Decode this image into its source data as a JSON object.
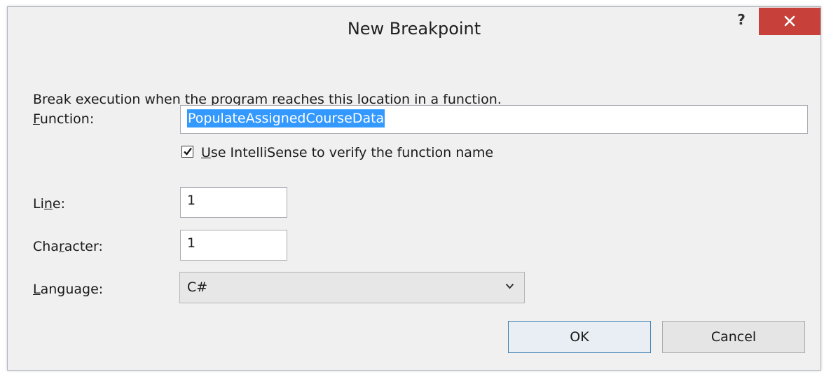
{
  "dialog": {
    "title": "New Breakpoint",
    "help_label": "?",
    "close_icon": "close-icon",
    "description": "Break execution when the program reaches this location in a function."
  },
  "function": {
    "label_mnemonic": "F",
    "label_rest": "unction:",
    "value": "PopulateAssignedCourseData",
    "value_selected": true
  },
  "intellisense": {
    "checked": true,
    "label_mnemonic": "U",
    "label_rest": "se IntelliSense to verify the function name"
  },
  "line": {
    "label_pre": "Li",
    "label_mnemonic": "n",
    "label_post": "e:",
    "value": "1"
  },
  "character": {
    "label_pre": "Cha",
    "label_mnemonic": "r",
    "label_post": "acter:",
    "value": "1"
  },
  "language": {
    "label_mnemonic": "L",
    "label_rest": "anguage:",
    "selected": "C#"
  },
  "buttons": {
    "ok": "OK",
    "cancel": "Cancel"
  },
  "colors": {
    "close_bg": "#c7403a",
    "selection": "#3399ff",
    "dialog_bg": "#f0f0f0"
  }
}
